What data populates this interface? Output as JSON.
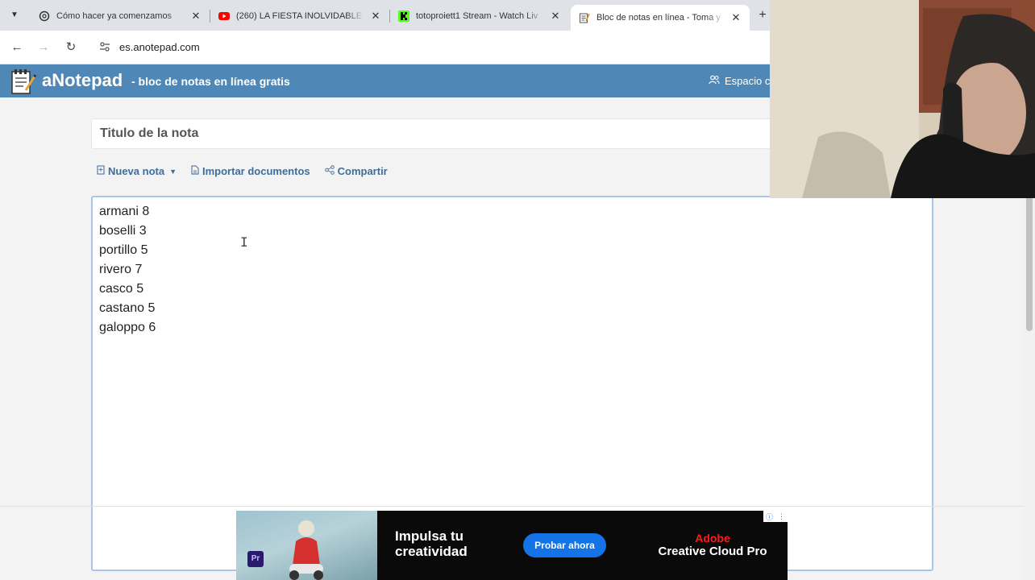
{
  "browser": {
    "tabs": [
      {
        "title": "Cómo hacer ya comenzamos",
        "favicon": "openai-icon",
        "active": false
      },
      {
        "title": "(260) LA FIESTA INOLVIDABLE D",
        "favicon": "youtube-icon",
        "active": false
      },
      {
        "title": "totoproiett1 Stream - Watch Liv",
        "favicon": "kick-icon",
        "active": false
      },
      {
        "title": "Bloc de notas en línea - Toma y",
        "favicon": "notepad-icon",
        "active": true
      }
    ],
    "url": "es.anotepad.com"
  },
  "site": {
    "brand": "aNotepad",
    "tagline": "- bloc de notas en línea gratis",
    "workspace": "Espacio c"
  },
  "note": {
    "title_placeholder": "Titulo de la nota",
    "actions": {
      "new_note": "Nueva nota",
      "import": "Importar documentos",
      "share": "Compartir"
    },
    "lines": [
      "armani 8",
      "boselli 3",
      "portillo 5",
      "rivero 7",
      "casco 5",
      "castano 5",
      "galoppo 6"
    ]
  },
  "ad": {
    "headline_1": "Impulsa tu",
    "headline_2": "creatividad",
    "cta": "Probar ahora",
    "brand_1": "Adobe",
    "brand_2": "Creative Cloud Pro",
    "badge": "Pr"
  },
  "colors": {
    "header": "#4f87b6",
    "link": "#3f6d98",
    "editor_border": "#a9c6e8",
    "cta": "#1473e6"
  }
}
